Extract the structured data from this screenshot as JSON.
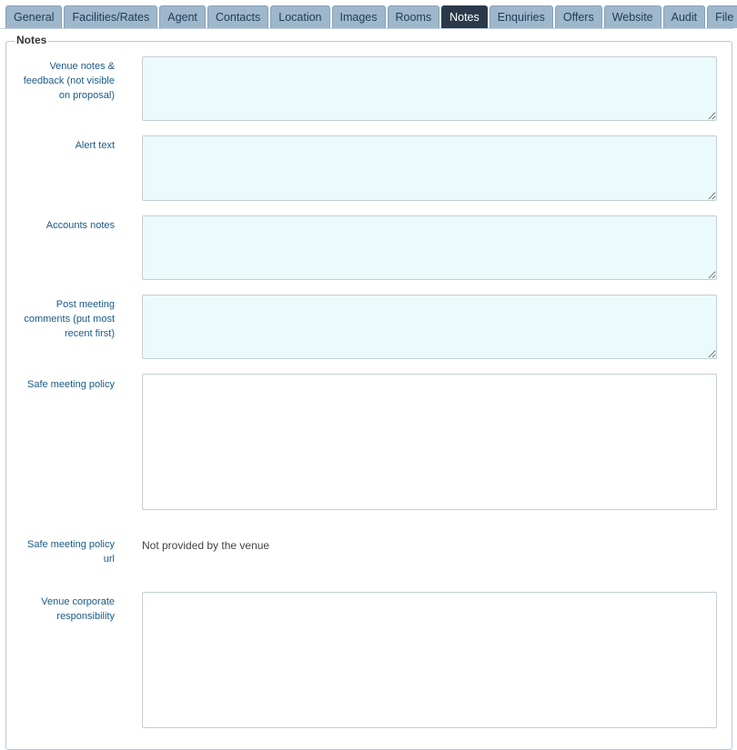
{
  "tabs": [
    {
      "label": "General"
    },
    {
      "label": "Facilities/Rates"
    },
    {
      "label": "Agent"
    },
    {
      "label": "Contacts"
    },
    {
      "label": "Location"
    },
    {
      "label": "Images"
    },
    {
      "label": "Rooms"
    },
    {
      "label": "Notes"
    },
    {
      "label": "Enquiries"
    },
    {
      "label": "Offers"
    },
    {
      "label": "Website"
    },
    {
      "label": "Audit"
    },
    {
      "label": "File Bank"
    }
  ],
  "active_tab": "Notes",
  "section": {
    "legend": "Notes"
  },
  "fields": {
    "venue_notes": {
      "label": "Venue notes & feedback (not visible on proposal)",
      "value": ""
    },
    "alert_text": {
      "label": "Alert text",
      "value": ""
    },
    "accounts_notes": {
      "label": "Accounts notes",
      "value": ""
    },
    "post_meeting": {
      "label": "Post meeting comments (put most recent first)",
      "value": ""
    },
    "safe_policy": {
      "label": "Safe meeting policy",
      "value": ""
    },
    "safe_policy_url": {
      "label": "Safe meeting policy url",
      "value": "Not provided by the venue"
    },
    "corporate_responsibility": {
      "label": "Venue corporate responsibility",
      "value": ""
    }
  },
  "colors": {
    "tab_bg": "#9fb7cb",
    "tab_active_bg": "#2a3a4a",
    "label_text": "#1a5a82",
    "editable_field_bg": "#ebfafa"
  }
}
